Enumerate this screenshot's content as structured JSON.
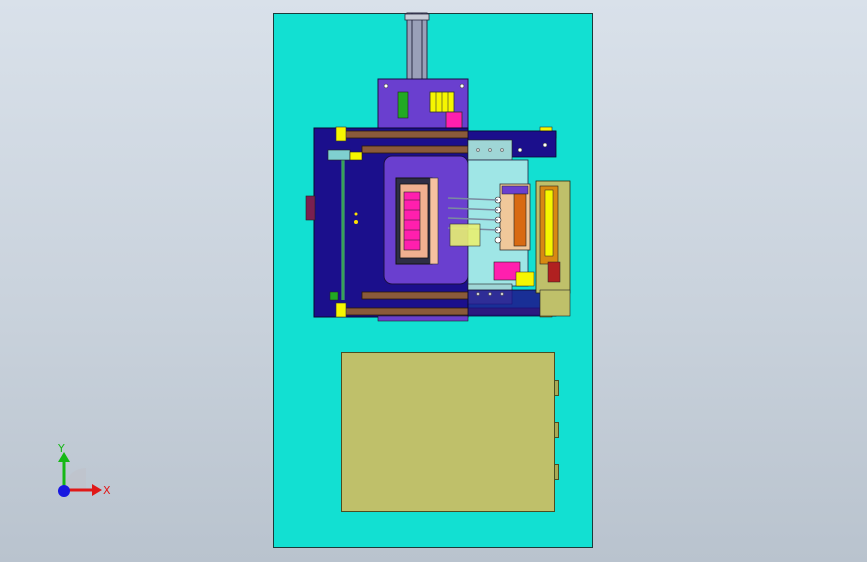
{
  "viewport": {
    "background": "#c9d2dc",
    "colors": {
      "base_plate": "#12e0d2",
      "mechanism_blue": "#1b0f8c",
      "purple_frame": "#6a3fcf",
      "rail_brown": "#8a5a3a",
      "control_box": "#bfc06a",
      "accent_yellow": "#f6f600",
      "accent_magenta": "#ff1fae",
      "accent_orange": "#d88a12"
    }
  },
  "axis_triad": {
    "y_label": "Y",
    "x_label": "X",
    "colors": {
      "y": "#16b816",
      "x": "#e01818",
      "z": "#1818e0"
    }
  },
  "icons": [
    "axis-triad-icon"
  ]
}
